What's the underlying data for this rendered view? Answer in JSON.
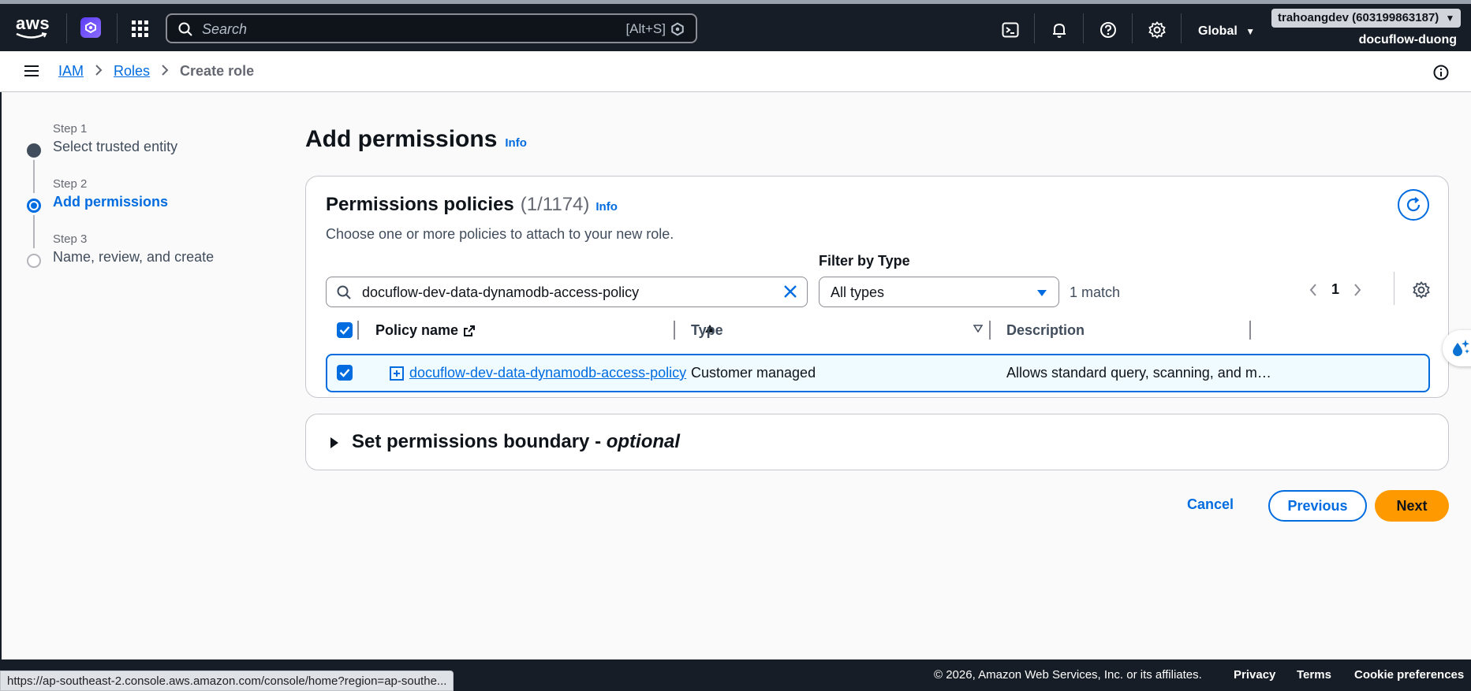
{
  "topbar": {
    "logo": "aws",
    "search_placeholder": "Search",
    "search_shortcut": "[Alt+S]",
    "region": "Global",
    "account_badge": "trahoangdev (603199863187)",
    "account_user": "docuflow-duong",
    "icons": [
      "cloudshell-icon",
      "bell-icon",
      "help-icon",
      "gear-icon"
    ]
  },
  "breadcrumb": {
    "items": [
      "IAM",
      "Roles"
    ],
    "current": "Create role"
  },
  "steps": [
    {
      "step": "Step 1",
      "title": "Select trusted entity",
      "state": "done"
    },
    {
      "step": "Step 2",
      "title": "Add permissions",
      "state": "active"
    },
    {
      "step": "Step 3",
      "title": "Name, review, and create",
      "state": "pending"
    }
  ],
  "page": {
    "title": "Add permissions",
    "info": "Info"
  },
  "policies": {
    "title": "Permissions policies",
    "count": "(1/1174)",
    "info": "Info",
    "description": "Choose one or more policies to attach to your new role.",
    "filter_label": "Filter by Type",
    "search_value": "docuflow-dev-data-dynamodb-access-policy",
    "type_value": "All types",
    "match_text": "1 match",
    "page": "1",
    "columns": [
      "Policy name",
      "Type",
      "Description"
    ],
    "rows": [
      {
        "name": "docuflow-dev-data-dynamodb-access-policy",
        "type": "Customer managed",
        "description": "Allows standard query, scanning, and me...",
        "selected": true
      }
    ]
  },
  "boundary": {
    "title": "Set permissions boundary - ",
    "title_optional": "optional"
  },
  "actions": {
    "cancel": "Cancel",
    "previous": "Previous",
    "next": "Next"
  },
  "footer": {
    "copyright": "© 2026, Amazon Web Services, Inc. or its affiliates.",
    "privacy": "Privacy",
    "terms": "Terms",
    "cookies": "Cookie preferences"
  },
  "status_url": "https://ap-southeast-2.console.aws.amazon.com/console/home?region=ap-southe...",
  "colors": {
    "nav_bg": "#161d26",
    "link": "#006ce0",
    "primary_button": "#ff9900"
  }
}
